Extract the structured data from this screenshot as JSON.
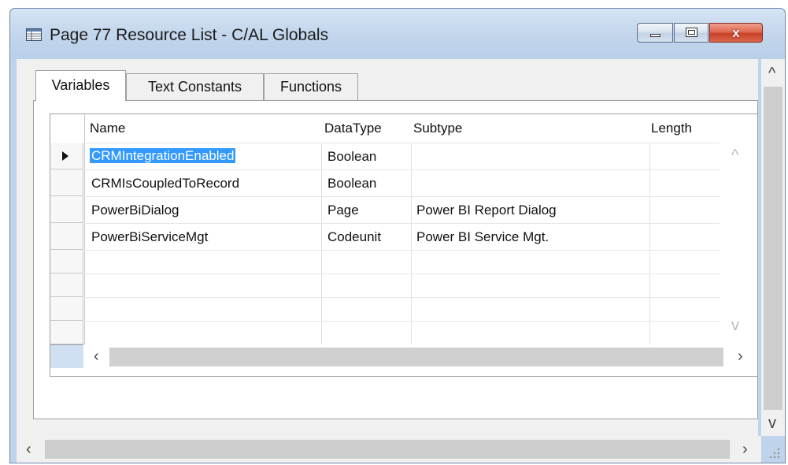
{
  "window": {
    "title": "Page 77 Resource List - C/AL Globals",
    "close_glyph": "x"
  },
  "tabs": [
    {
      "label": "Variables",
      "active": true
    },
    {
      "label": "Text Constants",
      "active": false
    },
    {
      "label": "Functions",
      "active": false
    }
  ],
  "grid": {
    "columns": [
      "Name",
      "DataType",
      "Subtype",
      "Length"
    ],
    "rows": [
      {
        "name": "CRMIntegrationEnabled",
        "datatype": "Boolean",
        "subtype": "",
        "length": "",
        "current": true
      },
      {
        "name": "CRMIsCoupledToRecord",
        "datatype": "Boolean",
        "subtype": "",
        "length": ""
      },
      {
        "name": "PowerBiDialog",
        "datatype": "Page",
        "subtype": "Power BI Report Dialog",
        "length": ""
      },
      {
        "name": "PowerBiServiceMgt",
        "datatype": "Codeunit",
        "subtype": "Power BI Service Mgt.",
        "length": ""
      }
    ]
  },
  "icons": {
    "app": "table-icon",
    "current_row": "row-pointer-icon",
    "scroll_left": "‹",
    "scroll_right": "›",
    "scroll_up": "^",
    "scroll_down": "v"
  },
  "colors": {
    "selection": "#3399ff",
    "close_button": "#c8402a",
    "title_bar": "#c3d6ec"
  }
}
